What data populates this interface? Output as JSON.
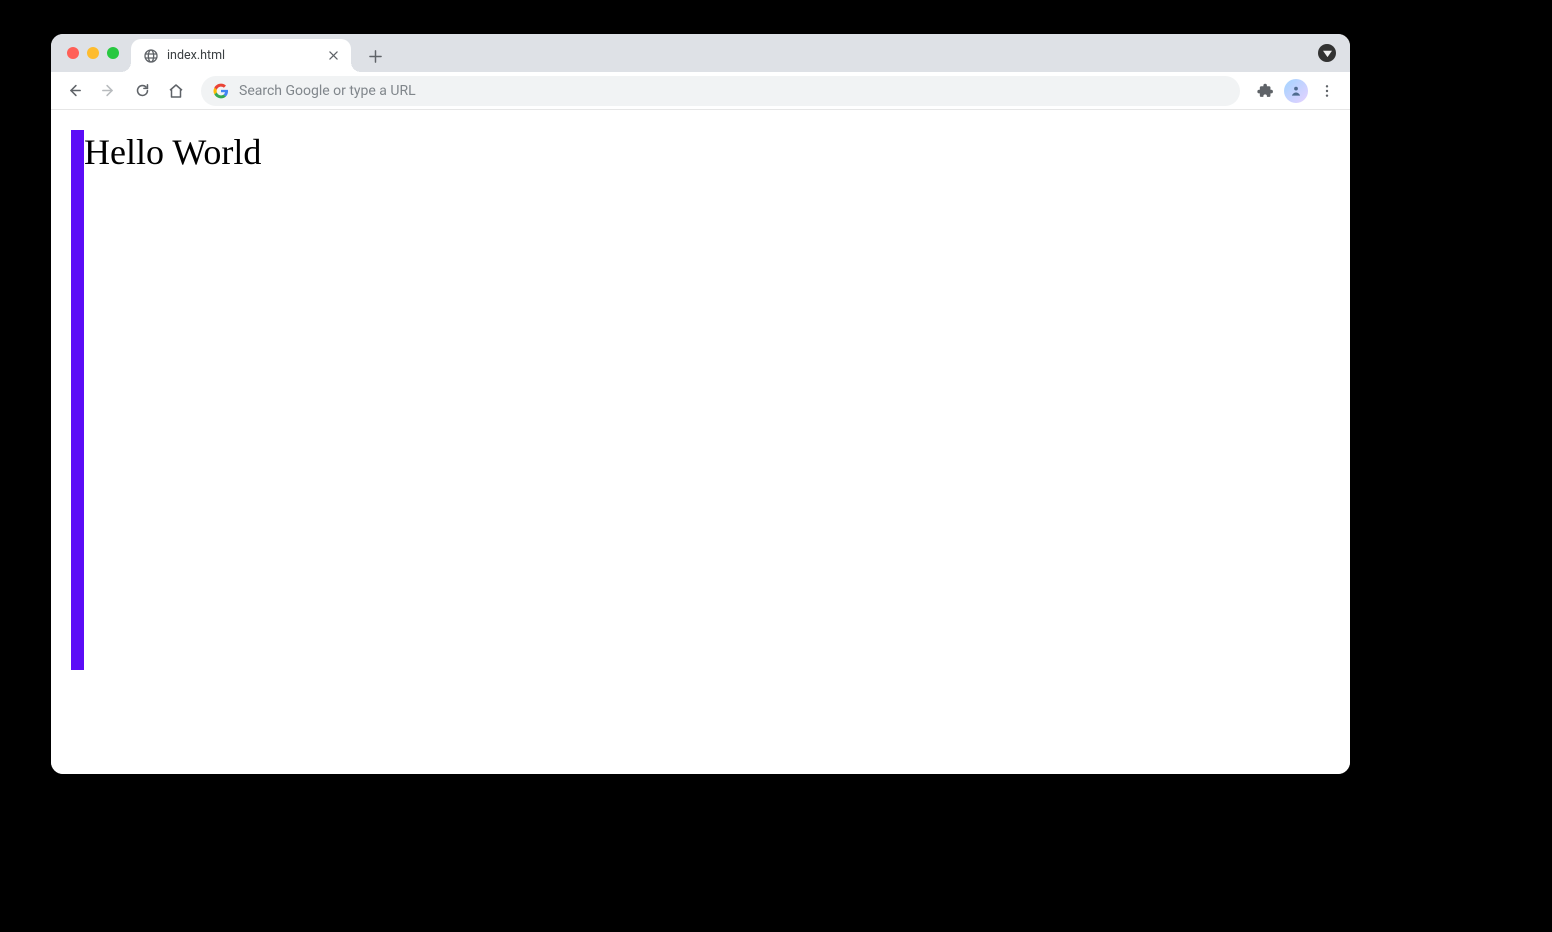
{
  "tab": {
    "title": "index.html"
  },
  "omnibox": {
    "placeholder": "Search Google or type a URL"
  },
  "page": {
    "heading": "Hello World"
  },
  "colors": {
    "bar": "#5b0cf7"
  }
}
